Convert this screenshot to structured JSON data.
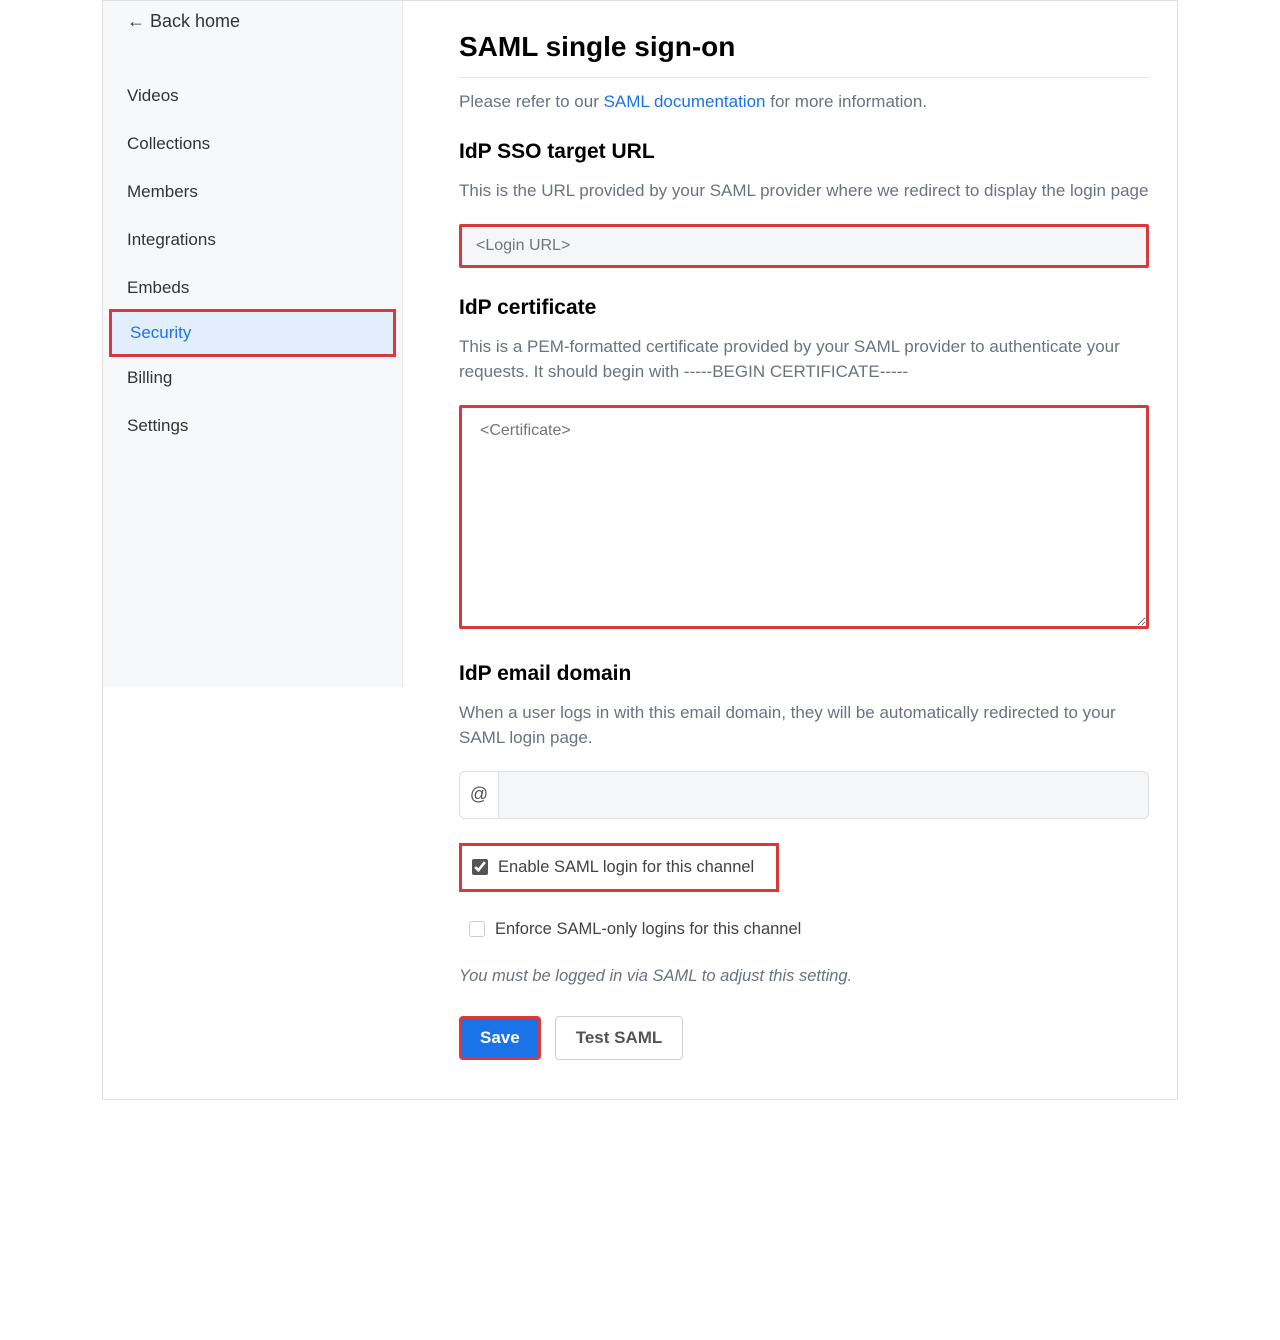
{
  "sidebar": {
    "back_label": "← Back home",
    "items": [
      {
        "label": "Videos"
      },
      {
        "label": "Collections"
      },
      {
        "label": "Members"
      },
      {
        "label": "Integrations"
      },
      {
        "label": "Embeds"
      },
      {
        "label": "Security"
      },
      {
        "label": "Billing"
      },
      {
        "label": "Settings"
      }
    ]
  },
  "main": {
    "title": "SAML single sign-on",
    "intro_prefix": "Please refer to our ",
    "intro_link": "SAML documentation",
    "intro_suffix": " for more information.",
    "idp_url_heading": "IdP SSO target URL",
    "idp_url_desc": "This is the URL provided by your SAML provider where we redirect to display the login page",
    "idp_url_placeholder": "<Login URL>",
    "idp_cert_heading": "IdP certificate",
    "idp_cert_desc": "This is a PEM-formatted certificate provided by your SAML provider to authenticate your requests. It should begin with -----BEGIN CERTIFICATE-----",
    "idp_cert_placeholder": "<Certificate>",
    "idp_email_heading": "IdP email domain",
    "idp_email_desc": "When a user logs in with this email domain, they will be automatically redirected to your SAML login page.",
    "at_symbol": "@",
    "email_input_value": "",
    "enable_saml_label": "Enable SAML login for this channel",
    "enforce_saml_label": "Enforce SAML-only logins for this channel",
    "enforce_note": "You must be logged in via SAML to adjust this setting.",
    "save_label": "Save",
    "test_label": "Test SAML"
  }
}
